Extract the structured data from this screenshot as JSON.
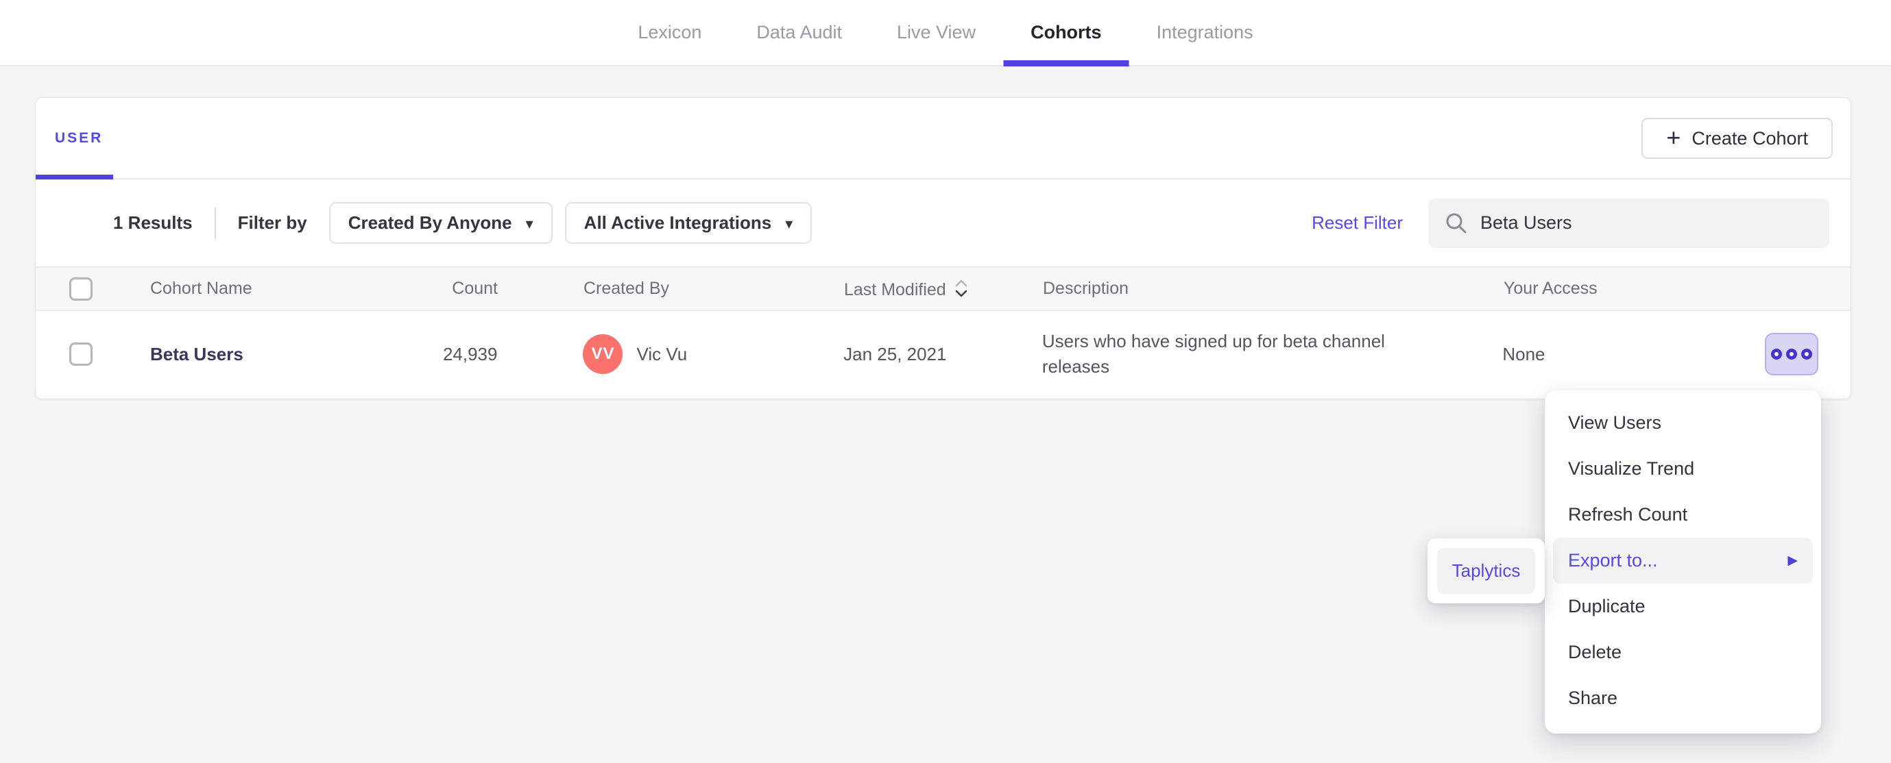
{
  "colors": {
    "accent_purple": "#5348e8",
    "underline_purple": "#4f42e0",
    "link_purple": "#5649e8",
    "dots_purple": "#4334cd",
    "avatar_coral": "#f9726c",
    "cohort_link_navy": "#39375f",
    "lavender_button_bg": "#d9d6f5",
    "page_background": "#f4f4f5",
    "menu_highlight": "#f3f3f5"
  },
  "nav": {
    "items": [
      {
        "label": "Lexicon"
      },
      {
        "label": "Data Audit"
      },
      {
        "label": "Live View"
      },
      {
        "label": "Cohorts"
      },
      {
        "label": "Integrations"
      }
    ],
    "active": "Cohorts"
  },
  "card": {
    "tab_label": "USER",
    "create_button_label": "Create Cohort"
  },
  "filters": {
    "results_label": "1 Results",
    "filter_by_label": "Filter by",
    "created_by_value": "Created By Anyone",
    "integrations_value": "All Active Integrations",
    "reset_label": "Reset Filter",
    "search_value": "Beta Users"
  },
  "table": {
    "headers": {
      "name": "Cohort Name",
      "count": "Count",
      "created_by": "Created By",
      "last_modified": "Last Modified",
      "description": "Description",
      "your_access": "Your Access"
    },
    "rows": [
      {
        "name": "Beta Users",
        "count": "24,939",
        "creator_initials": "VV",
        "creator_name": "Vic Vu",
        "last_modified": "Jan 25, 2021",
        "description": "Users who have signed up for beta channel releases",
        "your_access": "None"
      }
    ]
  },
  "context_menu": {
    "items": [
      {
        "label": "View Users"
      },
      {
        "label": "Visualize Trend"
      },
      {
        "label": "Refresh Count"
      },
      {
        "label": "Export to...",
        "highlighted": true,
        "has_submenu": true
      },
      {
        "label": "Duplicate"
      },
      {
        "label": "Delete"
      },
      {
        "label": "Share"
      }
    ]
  },
  "export_submenu": {
    "items": [
      {
        "label": "Taplytics"
      }
    ]
  },
  "icons": {
    "plus_glyph": "+",
    "caret_down_glyph": "▾",
    "submenu_arrow_glyph": "▶"
  }
}
